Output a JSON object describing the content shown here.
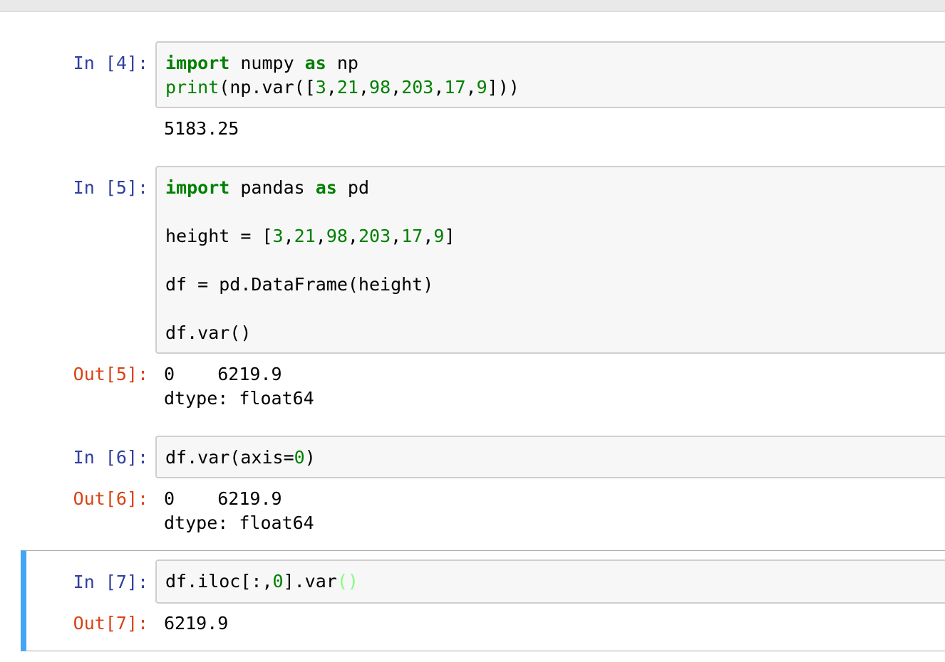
{
  "cells": [
    {
      "in_prompt": "In [4]:",
      "code_lines": [
        "import numpy as np",
        "print(np.var([3,21,98,203,17,9]))"
      ],
      "stream_output": "5183.25"
    },
    {
      "in_prompt": "In [5]:",
      "code_lines": [
        "import pandas as pd",
        "",
        "height = [3,21,98,203,17,9]",
        "",
        "df = pd.DataFrame(height)",
        "",
        "df.var()"
      ],
      "out_prompt": "Out[5]:",
      "output_lines": [
        "0    6219.9",
        "dtype: float64"
      ]
    },
    {
      "in_prompt": "In [6]:",
      "code_lines": [
        "df.var(axis=0)"
      ],
      "out_prompt": "Out[6]:",
      "output_lines": [
        "0    6219.9",
        "dtype: float64"
      ]
    },
    {
      "in_prompt": "In [7]:",
      "code_lines": [
        "df.iloc[:,0].var()"
      ],
      "out_prompt": "Out[7]:",
      "output_lines": [
        "6219.9"
      ],
      "selected": true
    }
  ],
  "colors": {
    "in_prompt": "#303f9f",
    "out_prompt": "#d84315",
    "keyword": "#008000",
    "number": "#008000",
    "selected_border": "#42a5f5",
    "matching_paren": "#7fff7f"
  }
}
